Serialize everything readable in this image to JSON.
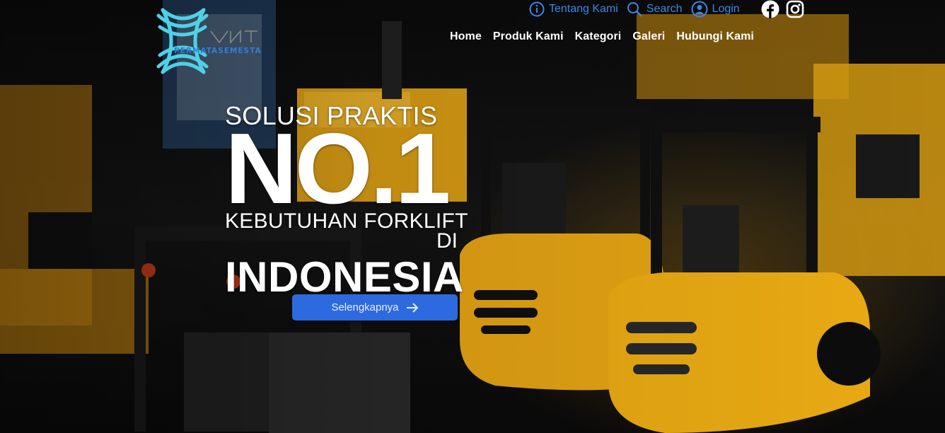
{
  "brand": {
    "name": "PERMATASEMESTA",
    "color": "#2b7fd6",
    "accent": "#4fd1e6"
  },
  "topbar": {
    "links": [
      {
        "icon": "info-icon",
        "label": "Tentang Kami"
      },
      {
        "icon": "search-icon",
        "label": "Search"
      },
      {
        "icon": "user-icon",
        "label": "Login"
      }
    ],
    "social": [
      "facebook-icon",
      "instagram-icon"
    ],
    "link_color": "#3d86e6"
  },
  "nav": {
    "items": [
      "Home",
      "Produk Kami",
      "Kategori",
      "Galeri",
      "Hubungi Kami"
    ]
  },
  "hero": {
    "line1": "SOLUSI PRAKTIS",
    "line2": "NO.1",
    "line3": "KEBUTUHAN FORKLIFT",
    "line4": "DI",
    "line5": "INDONESIA",
    "cta_label": "Selengkapnya",
    "cta_color": "#2d6ae0"
  }
}
